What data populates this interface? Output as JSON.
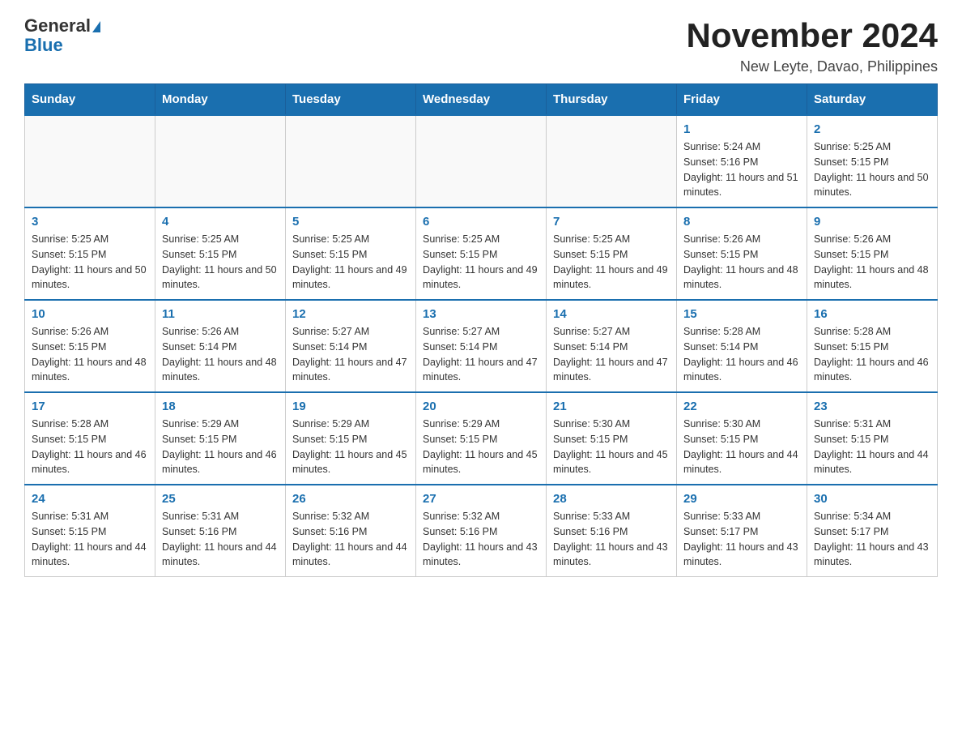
{
  "header": {
    "logo_general": "General",
    "logo_blue": "Blue",
    "title": "November 2024",
    "subtitle": "New Leyte, Davao, Philippines"
  },
  "days_of_week": [
    "Sunday",
    "Monday",
    "Tuesday",
    "Wednesday",
    "Thursday",
    "Friday",
    "Saturday"
  ],
  "weeks": [
    [
      {
        "day": "",
        "info": ""
      },
      {
        "day": "",
        "info": ""
      },
      {
        "day": "",
        "info": ""
      },
      {
        "day": "",
        "info": ""
      },
      {
        "day": "",
        "info": ""
      },
      {
        "day": "1",
        "info": "Sunrise: 5:24 AM\nSunset: 5:16 PM\nDaylight: 11 hours and 51 minutes."
      },
      {
        "day": "2",
        "info": "Sunrise: 5:25 AM\nSunset: 5:15 PM\nDaylight: 11 hours and 50 minutes."
      }
    ],
    [
      {
        "day": "3",
        "info": "Sunrise: 5:25 AM\nSunset: 5:15 PM\nDaylight: 11 hours and 50 minutes."
      },
      {
        "day": "4",
        "info": "Sunrise: 5:25 AM\nSunset: 5:15 PM\nDaylight: 11 hours and 50 minutes."
      },
      {
        "day": "5",
        "info": "Sunrise: 5:25 AM\nSunset: 5:15 PM\nDaylight: 11 hours and 49 minutes."
      },
      {
        "day": "6",
        "info": "Sunrise: 5:25 AM\nSunset: 5:15 PM\nDaylight: 11 hours and 49 minutes."
      },
      {
        "day": "7",
        "info": "Sunrise: 5:25 AM\nSunset: 5:15 PM\nDaylight: 11 hours and 49 minutes."
      },
      {
        "day": "8",
        "info": "Sunrise: 5:26 AM\nSunset: 5:15 PM\nDaylight: 11 hours and 48 minutes."
      },
      {
        "day": "9",
        "info": "Sunrise: 5:26 AM\nSunset: 5:15 PM\nDaylight: 11 hours and 48 minutes."
      }
    ],
    [
      {
        "day": "10",
        "info": "Sunrise: 5:26 AM\nSunset: 5:15 PM\nDaylight: 11 hours and 48 minutes."
      },
      {
        "day": "11",
        "info": "Sunrise: 5:26 AM\nSunset: 5:14 PM\nDaylight: 11 hours and 48 minutes."
      },
      {
        "day": "12",
        "info": "Sunrise: 5:27 AM\nSunset: 5:14 PM\nDaylight: 11 hours and 47 minutes."
      },
      {
        "day": "13",
        "info": "Sunrise: 5:27 AM\nSunset: 5:14 PM\nDaylight: 11 hours and 47 minutes."
      },
      {
        "day": "14",
        "info": "Sunrise: 5:27 AM\nSunset: 5:14 PM\nDaylight: 11 hours and 47 minutes."
      },
      {
        "day": "15",
        "info": "Sunrise: 5:28 AM\nSunset: 5:14 PM\nDaylight: 11 hours and 46 minutes."
      },
      {
        "day": "16",
        "info": "Sunrise: 5:28 AM\nSunset: 5:15 PM\nDaylight: 11 hours and 46 minutes."
      }
    ],
    [
      {
        "day": "17",
        "info": "Sunrise: 5:28 AM\nSunset: 5:15 PM\nDaylight: 11 hours and 46 minutes."
      },
      {
        "day": "18",
        "info": "Sunrise: 5:29 AM\nSunset: 5:15 PM\nDaylight: 11 hours and 46 minutes."
      },
      {
        "day": "19",
        "info": "Sunrise: 5:29 AM\nSunset: 5:15 PM\nDaylight: 11 hours and 45 minutes."
      },
      {
        "day": "20",
        "info": "Sunrise: 5:29 AM\nSunset: 5:15 PM\nDaylight: 11 hours and 45 minutes."
      },
      {
        "day": "21",
        "info": "Sunrise: 5:30 AM\nSunset: 5:15 PM\nDaylight: 11 hours and 45 minutes."
      },
      {
        "day": "22",
        "info": "Sunrise: 5:30 AM\nSunset: 5:15 PM\nDaylight: 11 hours and 44 minutes."
      },
      {
        "day": "23",
        "info": "Sunrise: 5:31 AM\nSunset: 5:15 PM\nDaylight: 11 hours and 44 minutes."
      }
    ],
    [
      {
        "day": "24",
        "info": "Sunrise: 5:31 AM\nSunset: 5:15 PM\nDaylight: 11 hours and 44 minutes."
      },
      {
        "day": "25",
        "info": "Sunrise: 5:31 AM\nSunset: 5:16 PM\nDaylight: 11 hours and 44 minutes."
      },
      {
        "day": "26",
        "info": "Sunrise: 5:32 AM\nSunset: 5:16 PM\nDaylight: 11 hours and 44 minutes."
      },
      {
        "day": "27",
        "info": "Sunrise: 5:32 AM\nSunset: 5:16 PM\nDaylight: 11 hours and 43 minutes."
      },
      {
        "day": "28",
        "info": "Sunrise: 5:33 AM\nSunset: 5:16 PM\nDaylight: 11 hours and 43 minutes."
      },
      {
        "day": "29",
        "info": "Sunrise: 5:33 AM\nSunset: 5:17 PM\nDaylight: 11 hours and 43 minutes."
      },
      {
        "day": "30",
        "info": "Sunrise: 5:34 AM\nSunset: 5:17 PM\nDaylight: 11 hours and 43 minutes."
      }
    ]
  ]
}
